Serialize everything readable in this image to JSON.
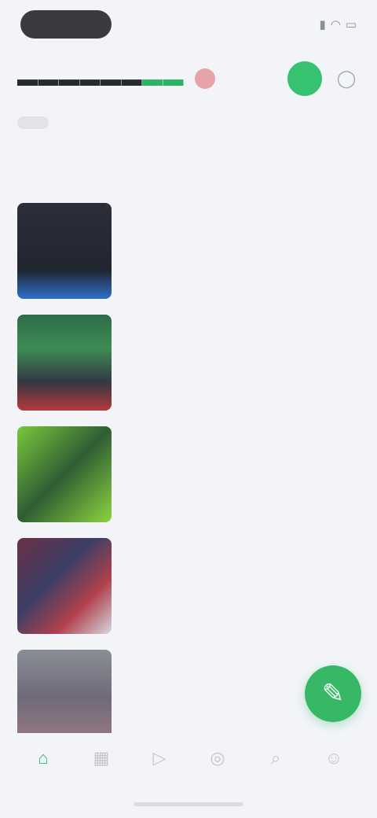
{
  "status_bar": {
    "time": "",
    "icons": [
      "signal-icon",
      "wifi-icon",
      "battery-icon"
    ]
  },
  "header": {
    "logo_dark": "",
    "logo_green": "",
    "icons": [
      "live-icon",
      "account-icon"
    ]
  },
  "tabs": [
    {
      "label": "",
      "active": true
    },
    {
      "label": "",
      "active": false
    },
    {
      "label": "",
      "active": false
    },
    {
      "label": "",
      "active": false
    }
  ],
  "section": {
    "title": ""
  },
  "news": [
    {
      "category": "",
      "headline": "",
      "meta": ""
    },
    {
      "category": "",
      "headline": "",
      "meta": ""
    },
    {
      "category": "",
      "headline": "",
      "meta": ""
    },
    {
      "category": "",
      "headline": "",
      "meta": ""
    },
    {
      "category": "",
      "headline": "",
      "meta": ""
    }
  ],
  "fab": {
    "icon": "compose-icon"
  },
  "bottom_nav": [
    {
      "icon": "home-icon",
      "active": true
    },
    {
      "icon": "scores-icon",
      "active": false
    },
    {
      "icon": "video-icon",
      "active": false
    },
    {
      "icon": "community-icon",
      "active": false
    },
    {
      "icon": "search-icon",
      "active": false
    },
    {
      "icon": "profile-icon",
      "active": false
    }
  ],
  "colors": {
    "background": "#f3f4f8",
    "accent_green": "#37b866",
    "text_dark": "#26292f",
    "badge_pink": "#e6a3a8"
  }
}
